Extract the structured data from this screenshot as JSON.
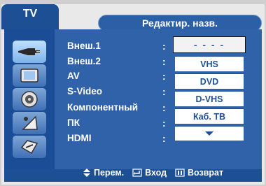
{
  "tab": {
    "label": "TV"
  },
  "header": {
    "title": "Редактир. назв."
  },
  "sources": [
    {
      "label": "Внеш.1",
      "highlighted": true
    },
    {
      "label": "Внеш.2"
    },
    {
      "label": "AV"
    },
    {
      "label": "S-Video"
    },
    {
      "label": "Компонентный"
    },
    {
      "label": "ПК"
    },
    {
      "label": "HDMI"
    }
  ],
  "separator": ":",
  "name_editor": {
    "current_value": "- - - -",
    "options": [
      "VHS",
      "DVD",
      "D-VHS",
      "Каб. ТВ"
    ],
    "more_indicator": "down-arrow"
  },
  "side_menu": [
    {
      "icon": "input-icon",
      "active": true
    },
    {
      "icon": "picture-icon"
    },
    {
      "icon": "sound-icon"
    },
    {
      "icon": "channel-icon"
    },
    {
      "icon": "setup-icon"
    }
  ],
  "footer": {
    "move": "Перем.",
    "enter": "Вход",
    "return": "Возврат"
  },
  "colors": {
    "panel": "#2f62a8",
    "tab": "#1d4f95",
    "accent": "#f2f2f2"
  }
}
